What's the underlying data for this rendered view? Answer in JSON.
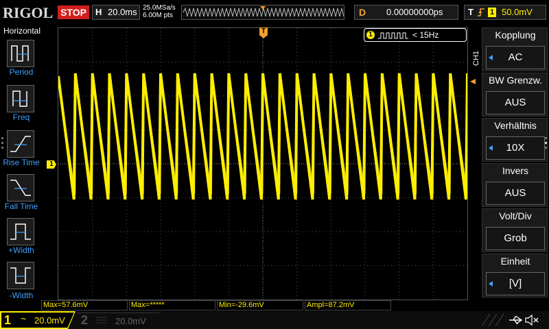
{
  "brand": "RIGOL",
  "run_state": "STOP",
  "timebase": {
    "label": "H",
    "value": "20.0ms"
  },
  "sampling": {
    "rate": "25.0MSa/s",
    "points": "6.00M pts"
  },
  "delay": {
    "label": "D",
    "value": "0.00000000ps"
  },
  "trigger": {
    "label": "T",
    "source": "1",
    "level": "50.0mV"
  },
  "left_panel": {
    "title": "Horizontal",
    "items": [
      {
        "label": "Period",
        "icon": "period-icon"
      },
      {
        "label": "Freq",
        "icon": "freq-icon"
      },
      {
        "label": "Rise Time",
        "icon": "rise-time-icon"
      },
      {
        "label": "Fall Time",
        "icon": "fall-time-icon"
      },
      {
        "label": "+Width",
        "icon": "positive-width-icon"
      },
      {
        "label": "-Width",
        "icon": "negative-width-icon"
      }
    ]
  },
  "freq_counter": {
    "channel": "1",
    "text": "< 15Hz"
  },
  "channel_tag": "CH1",
  "ground_marker": "1",
  "trigger_marker": "T",
  "right_panel": [
    {
      "title": "Kopplung",
      "value": "AC",
      "has_arrow": true
    },
    {
      "title": "BW Grenzw.",
      "value": "AUS",
      "has_arrow": false
    },
    {
      "title": "Verhältnis",
      "value": "10X",
      "has_arrow": true
    },
    {
      "title": "Invers",
      "value": "AUS",
      "has_arrow": false
    },
    {
      "title": "Volt/Div",
      "value": "Grob",
      "has_arrow": false
    },
    {
      "title": "Einheit",
      "value": "[V]",
      "has_arrow": true
    }
  ],
  "measurements": [
    {
      "text": "Max=57.6mV"
    },
    {
      "text": "Max=*****"
    },
    {
      "text": "Min=-29.6mV"
    },
    {
      "text": "Ampl=87.2mV"
    }
  ],
  "bottom": {
    "ch1": {
      "num": "1",
      "coupling": "~",
      "scale": "20.0mV"
    },
    "ch2": {
      "num": "2",
      "scale": "20.0mV"
    }
  },
  "colors": {
    "ch1": "#ffee00",
    "accent_blue": "#3fa0ff",
    "stop": "#d21e1e",
    "trigger": "#f0a030"
  },
  "waveform": {
    "cycles": 24,
    "shape": "sawtooth-falling"
  }
}
